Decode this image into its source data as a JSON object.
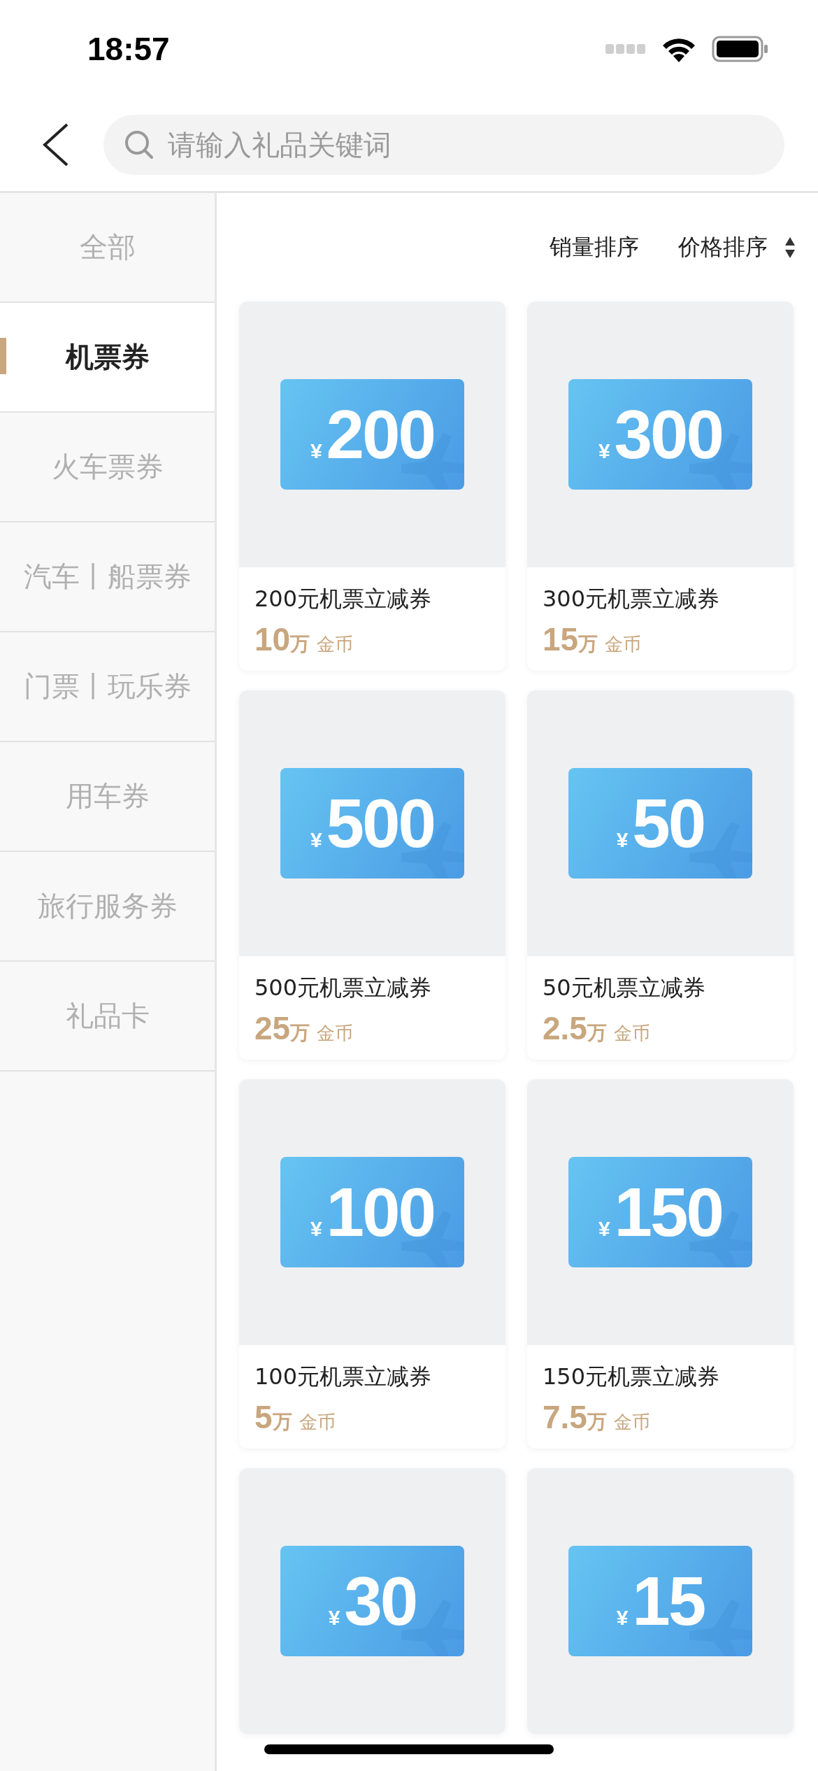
{
  "status_bar": {
    "time": "18:57"
  },
  "search": {
    "placeholder": "请输入礼品关键词"
  },
  "sidebar": {
    "items": [
      {
        "label": "全部",
        "selected": false
      },
      {
        "label": "机票券",
        "selected": true
      },
      {
        "label": "火车票券",
        "selected": false
      },
      {
        "label": "汽车丨船票券",
        "selected": false
      },
      {
        "label": "门票丨玩乐券",
        "selected": false
      },
      {
        "label": "用车券",
        "selected": false
      },
      {
        "label": "旅行服务券",
        "selected": false
      },
      {
        "label": "礼品卡",
        "selected": false
      }
    ]
  },
  "sort": [
    {
      "label": "销量排序",
      "kind": "plain"
    },
    {
      "label": "价格排序",
      "kind": "toggle"
    }
  ],
  "products": [
    {
      "ticket": {
        "currency": "¥",
        "amount": "200"
      },
      "name": "200元机票立减券",
      "price": "10",
      "unit": "万",
      "coin": "金币"
    },
    {
      "ticket": {
        "currency": "¥",
        "amount": "300"
      },
      "name": "300元机票立减券",
      "price": "15",
      "unit": "万",
      "coin": "金币"
    },
    {
      "ticket": {
        "currency": "¥",
        "amount": "500"
      },
      "name": "500元机票立减券",
      "price": "25",
      "unit": "万",
      "coin": "金币"
    },
    {
      "ticket": {
        "currency": "¥",
        "amount": "50"
      },
      "name": "50元机票立减券",
      "price": "2.5",
      "unit": "万",
      "coin": "金币"
    },
    {
      "ticket": {
        "currency": "¥",
        "amount": "100"
      },
      "name": "100元机票立减券",
      "price": "5",
      "unit": "万",
      "coin": "金币"
    },
    {
      "ticket": {
        "currency": "¥",
        "amount": "150"
      },
      "name": "150元机票立减券",
      "price": "7.5",
      "unit": "万",
      "coin": "金币"
    },
    {
      "ticket": {
        "currency": "¥",
        "amount": "30"
      }
    },
    {
      "ticket": {
        "currency": "¥",
        "amount": "15"
      }
    }
  ]
}
